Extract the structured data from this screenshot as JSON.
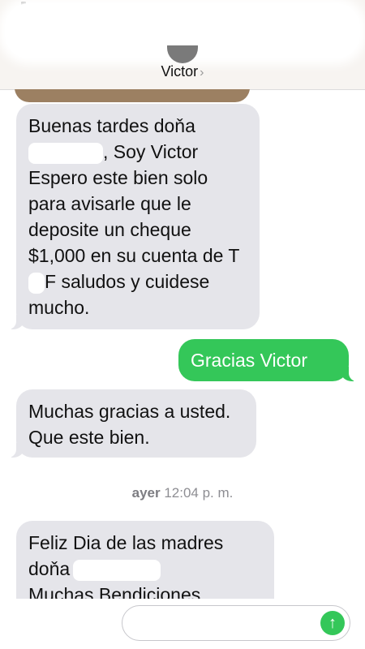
{
  "header": {
    "contact_name": "Victor",
    "chevron": "›"
  },
  "messages": [
    {
      "direction": "received",
      "parts": [
        "Buenas tardes doňa",
        ", Soy Victor Espero este bien solo para avisarle que le deposite un cheque $1,000 en su cuenta de T",
        "F saludos y cuidese mucho."
      ]
    },
    {
      "direction": "sent",
      "text": "Gracias Victor"
    },
    {
      "direction": "received",
      "text": "Muchas gracias a usted. Que este bien."
    },
    {
      "direction": "received",
      "parts": [
        "Feliz Dia de las madres",
        "doňa",
        "Muchas Bendiciones"
      ]
    }
  ],
  "timestamp": {
    "day": "ayer",
    "time": "12:04 p. m."
  },
  "composer": {
    "send_icon": "arrow-up-icon",
    "accent": "#34c759"
  }
}
